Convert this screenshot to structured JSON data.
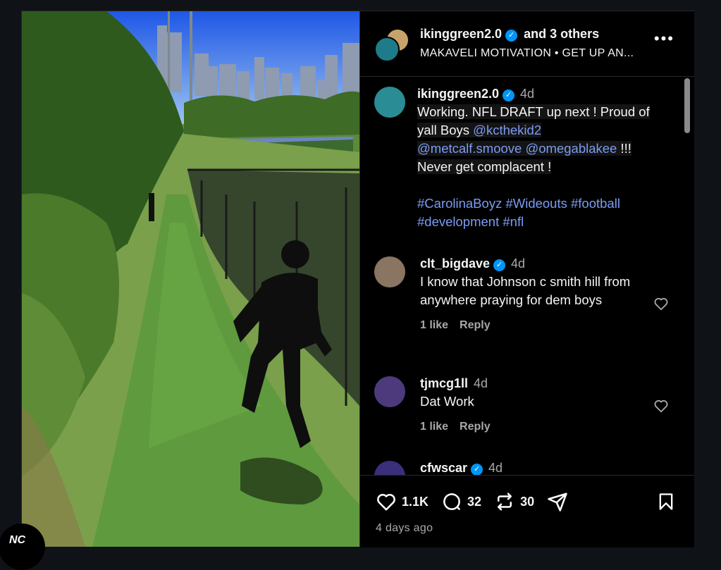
{
  "header": {
    "username": "ikinggreen2.0",
    "and_others": "and 3 others",
    "audio": "MAKAVELI MOTIVATION • GET UP AN...",
    "more_label": "•••"
  },
  "caption": {
    "username": "ikinggreen2.0",
    "time": "4d",
    "line1": "Working. NFL DRAFT up next ! Proud of",
    "line2a": "yall Boys ",
    "mention1": "@kcthekid2",
    "mention2": "@metcalf.smoove",
    "mention3": "@omegablakee",
    "line3b": " !!!",
    "line4": "Never get complacent !",
    "tags1": "#CarolinaBoyz #Wideouts #football",
    "tags2": "#development #nfl"
  },
  "comments": [
    {
      "username": "clt_bigdave",
      "time": "4d",
      "text": "I know that Johnson c smith hill from anywhere praying for dem boys",
      "likes": "1 like",
      "reply": "Reply"
    },
    {
      "username": "tjmcg1ll",
      "time": "4d",
      "text": "Dat Work",
      "likes": "1 like",
      "reply": "Reply"
    },
    {
      "username": "cfwscar",
      "time": "4d"
    }
  ],
  "actions": {
    "likes": "1.1K",
    "comments": "32",
    "reposts": "30"
  },
  "posted_ago": "4 days ago",
  "corner_logo": "NC",
  "colors": {
    "verified": "#0095f6",
    "link": "#7b9cf4",
    "muted": "#a8a8a8",
    "background": "#000000"
  },
  "icons": [
    "verified-icon",
    "more-icon",
    "heart-icon",
    "comment-icon",
    "repost-icon",
    "share-icon",
    "bookmark-icon"
  ]
}
